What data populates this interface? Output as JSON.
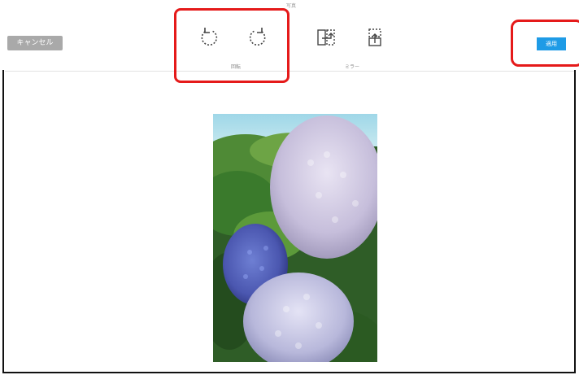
{
  "window": {
    "title": "写真"
  },
  "toolbar": {
    "cancel_label": "キャンセル",
    "rotate_label": "回転",
    "mirror_label": "ミラー",
    "apply_label": "適用"
  },
  "icons": {
    "rotate_left": "rotate-left-icon",
    "rotate_right": "rotate-right-icon",
    "mirror_horizontal": "mirror-horizontal-icon",
    "mirror_vertical": "mirror-vertical-icon"
  },
  "colors": {
    "apply_button": "#1e9be6",
    "cancel_button": "#a9a9a9",
    "highlight": "#e51a1a"
  }
}
